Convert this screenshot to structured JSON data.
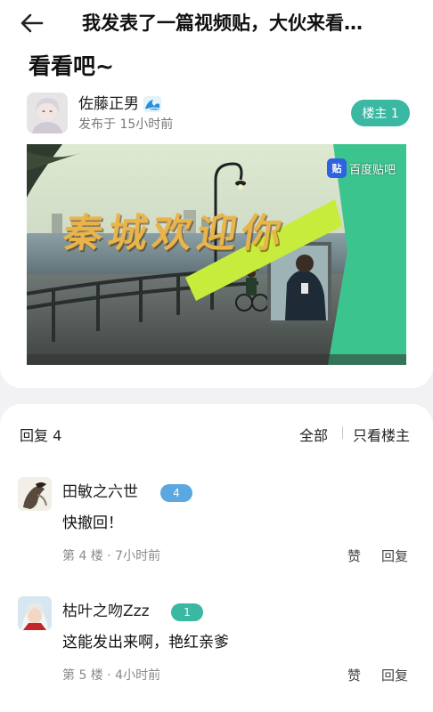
{
  "header": {
    "title": "我发表了一篇视频贴，大伙来看…",
    "title_tail": "看看吧~"
  },
  "post": {
    "author_name": "佐藤正男",
    "author_badge_icon": "wave-icon",
    "published": "发布于 15小时前",
    "floor_badge": "楼主 1"
  },
  "video": {
    "watermark_logo": "贴",
    "watermark_text": "百度贴吧",
    "overlay_text": "秦城欢迎你",
    "accent_color": "#3cc48f",
    "highlight_color": "#c8ec3c"
  },
  "replies": {
    "count_label": "回复 4",
    "filter_all": "全部",
    "filter_op": "只看楼主"
  },
  "comments": [
    {
      "user": "田敏之六世",
      "level": "4",
      "level_color": "#5ba7e0",
      "text": "快撤回！",
      "meta": "第 4 楼 · 7小时前",
      "like": "赞",
      "reply": "回复"
    },
    {
      "user": "枯叶之吻Zzz",
      "level": "1",
      "level_color": "#3ab8a2",
      "text": "这能发出来啊，艳红亲爹",
      "meta": "第 5 楼 · 4小时前",
      "like": "赞",
      "reply": "回复"
    }
  ],
  "colors": {
    "teal": "#3ab8a2",
    "background": "#f2f2f4"
  }
}
